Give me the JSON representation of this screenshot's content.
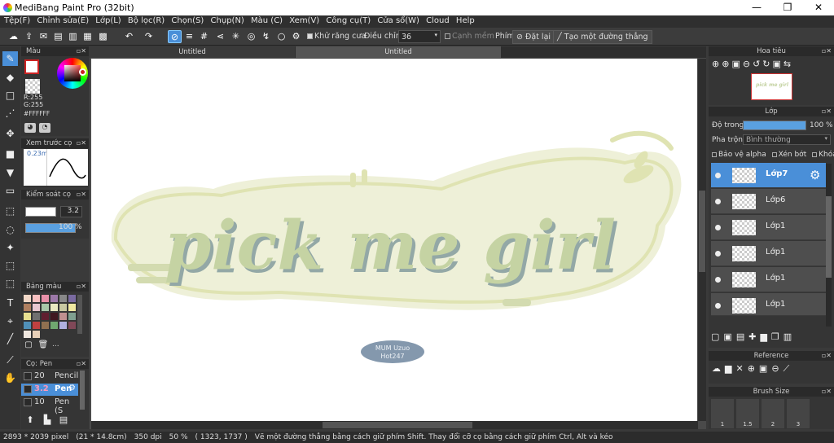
{
  "window": {
    "title": "MediBang Paint Pro (32bit)",
    "minimize": "—",
    "restore": "❐",
    "close": "✕"
  },
  "menu": [
    "Tệp(F)",
    "Chỉnh sửa(E)",
    "Lớp(L)",
    "Bộ lọc(R)",
    "Chọn(S)",
    "Chụp(N)",
    "Màu (C)",
    "Xem(V)",
    "Công cụ(T)",
    "Cửa sổ(W)",
    "Cloud",
    "Help"
  ],
  "toolbar": {
    "antialias_label": "Khử răng cưa",
    "adjust_label": "Điều chỉnh",
    "adjust_value": "36",
    "soften_label": "Cạnh mềm",
    "key_label": "Phím",
    "reset_label": "Đặt lại",
    "line_label": "Tạo một đường thẳng"
  },
  "color_panel": {
    "title": "Màu",
    "r": "R:255",
    "g": "G:255",
    "hex": "#FFFFFF",
    "primary": "#ffffff",
    "accent": "#cc2222"
  },
  "brush_preview": {
    "title": "Xem trước cọ",
    "size": "0.23m"
  },
  "brush_control": {
    "title": "Kiểm soát cọ",
    "size": "3.2",
    "opacity": "100 %"
  },
  "palette": {
    "title": "Bảng màu",
    "more": "...",
    "colors": [
      "#f3d9c8",
      "#f8c0c0",
      "#e890a8",
      "#9c78a8",
      "#888888",
      "#7a6aa0",
      "#b08060",
      "#e8c8d0",
      "#a8c8a8",
      "#e8e8c0",
      "#c8c8a0",
      "#f0e8a0",
      "#e8e090",
      "#707070",
      "#602030",
      "#401820",
      "#c09090",
      "#80a090",
      "#5090b8",
      "#c04040",
      "#907050",
      "#70a870",
      "#b0b0e0",
      "#804858",
      "#f0e8e0",
      "#e8d0b8"
    ]
  },
  "brush_list": {
    "title": "Cọ: Pen",
    "items": [
      {
        "size": "20",
        "name": "Pencil"
      },
      {
        "size": "3.2",
        "name": "Pen"
      },
      {
        "size": "10",
        "name": "Pen (S"
      }
    ]
  },
  "tabs": [
    "Untitled",
    "Untitled"
  ],
  "artwork": {
    "text": "pick me girl",
    "stamp1": "MUM Uzuo",
    "stamp2": "Hot247",
    "colors": {
      "outer": "#eef0d8",
      "outline": "#dfe3b2",
      "fill": "#c5d3a3",
      "shadow": "#93a8a6",
      "stamp": "#8498ad"
    }
  },
  "navigator": {
    "title": "Hoa tiêu",
    "thumb_text": "pick me girl"
  },
  "layer_panel": {
    "title": "Lớp",
    "opacity_label": "Độ trong",
    "opacity_value": "100 %",
    "opacity_fill": 1.0,
    "blend_label": "Pha trộn",
    "blend_value": "Bình thường",
    "protect_alpha": "Bảo vệ alpha",
    "clip": "Xén bớt",
    "lock": "Khóa",
    "layers": [
      "Lớp7",
      "Lớp6",
      "Lớp1",
      "Lớp1",
      "Lớp1",
      "Lớp1"
    ]
  },
  "reference": {
    "title": "Reference"
  },
  "brush_size": {
    "title": "Brush Size",
    "labels": [
      "1",
      "1.5",
      "2",
      "3"
    ]
  },
  "status": {
    "size": "2893 * 2039 pixel",
    "cm": "(21 * 14.8cm)",
    "dpi": "350 dpi",
    "zoom": "50 %",
    "coords": "( 1323, 1737 )",
    "hint": "Vẽ một đường thẳng bằng cách giữ phím Shift. Thay đổi cỡ cọ bằng cách giữ phím Ctrl, Alt và kéo"
  }
}
